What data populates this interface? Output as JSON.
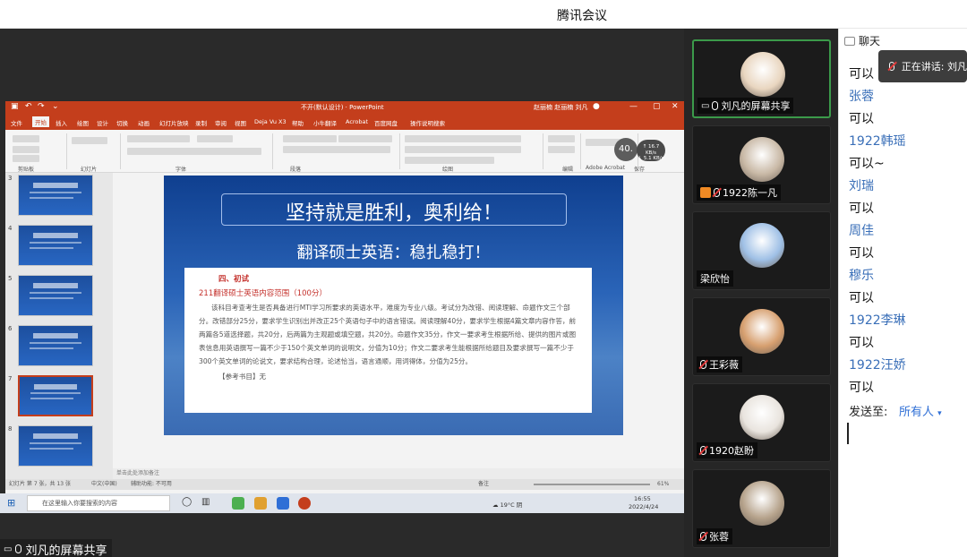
{
  "app": {
    "title": "腾讯会议"
  },
  "ppt": {
    "doc_title": "不开(默认设计) · PowerPoint",
    "user": "赵丽楠 赵丽楠 刘凡",
    "tabs": [
      "文件",
      "开始",
      "插入",
      "绘图",
      "设计",
      "切换",
      "动画",
      "幻灯片放映",
      "录制",
      "审阅",
      "视图",
      "Deja Vu X3",
      "帮助",
      "小牛翻译",
      "Acrobat",
      "百度网盘",
      "操作说明搜索"
    ],
    "active_tab": "开始",
    "ribbon_groups": [
      "剪贴板",
      "幻灯片",
      "字体",
      "段落",
      "绘图",
      "编辑",
      "Adobe Acrobat",
      "保存"
    ],
    "zoom_bubble": "40.",
    "net_stats": [
      "↑ 16.7 KB/s",
      "↓ 5.1 KB/s"
    ],
    "thumb_numbers": [
      "3",
      "4",
      "5",
      "6",
      "7",
      "8"
    ],
    "selected_thumb": "7",
    "notes_placeholder": "单击此处添加备注",
    "status_left": "幻灯片 第 7 张，共 13 张",
    "status_lang": "中文(中国)",
    "status_access": "辅助功能: 不可用",
    "status_notes": "备注",
    "status_zoom": "61%"
  },
  "slide": {
    "title": "坚持就是胜利，奥利给！",
    "subtitle": "翻译硕士英语：稳扎稳打！",
    "section": "四、初试",
    "sub_heading": "211翻译硕士英语内容范围（100分）",
    "paragraph": "该科目考查考生是否具备进行MTI学习所要求的英语水平，难度为专业八级。考试分为改错、阅读理解、命题作文三个部分。改错部分25分，要求学生识别出并改正25个英语句子中的语言错误。阅读理解40分，要求学生根据4篇文章内容作答，前两篇各5道选择题，共20分，后两篇为主观题或填空题，共20分。命题作文35分，作文一要求考生根据所给、提供的图片或图表信息用英语撰写一篇不少于150个英文单词的说明文，分值为10分；作文二要求考生能根据所给题目及要求撰写一篇不少于300个英文单词的论说文，要求结构合理，论述恰当，语言通顺，用词得体，分值为25分。",
    "reference": "【参考书目】无"
  },
  "taskbar": {
    "search_placeholder": "在这里输入你要搜索的内容",
    "weather": "19°C 阴",
    "time": "16:55",
    "date": "2022/4/24"
  },
  "share_label": "刘凡的屏幕共享",
  "participants": [
    {
      "label": "刘凡的屏幕共享",
      "active": true,
      "mic": "on",
      "screen": true,
      "avatar_color": "#e9d6c0"
    },
    {
      "label": "1922陈一凡",
      "active": false,
      "mic": "off",
      "screen": false,
      "host": true,
      "avatar_color": "#c9b9a6"
    },
    {
      "label": "梁欣怡",
      "active": false,
      "mic": "none",
      "screen": false,
      "avatar_color": "#9fc0e6"
    },
    {
      "label": "王彩薇",
      "active": false,
      "mic": "off",
      "screen": false,
      "avatar_color": "#d7a070"
    },
    {
      "label": "1920赵盼",
      "active": false,
      "mic": "off",
      "screen": false,
      "avatar_color": "#e9e4de"
    },
    {
      "label": "张蓉",
      "active": false,
      "mic": "off",
      "screen": false,
      "avatar_color": "#b7a48d"
    }
  ],
  "chat": {
    "title": "聊天",
    "speaking": "正在讲话: 刘凡",
    "messages": [
      {
        "kind": "text",
        "value": "可以"
      },
      {
        "kind": "name",
        "value": "张蓉"
      },
      {
        "kind": "text",
        "value": "可以"
      },
      {
        "kind": "name",
        "value": "1922韩瑶"
      },
      {
        "kind": "text",
        "value": "可以~"
      },
      {
        "kind": "name",
        "value": "刘瑞"
      },
      {
        "kind": "text",
        "value": "可以"
      },
      {
        "kind": "name",
        "value": "周佳"
      },
      {
        "kind": "text",
        "value": "可以"
      },
      {
        "kind": "name",
        "value": "穆乐"
      },
      {
        "kind": "text",
        "value": "可以"
      },
      {
        "kind": "name",
        "value": "1922李琳"
      },
      {
        "kind": "text",
        "value": "可以"
      },
      {
        "kind": "name",
        "value": "1922汪娇"
      },
      {
        "kind": "text",
        "value": "可以"
      }
    ],
    "send_to_label": "发送至:",
    "send_to_value": "所有人"
  },
  "colors": {
    "ppt_red": "#c43e1c",
    "chat_name": "#3a6fb8",
    "accent_blue": "#2f6fd6",
    "active_tile": "#3b9a4a"
  }
}
